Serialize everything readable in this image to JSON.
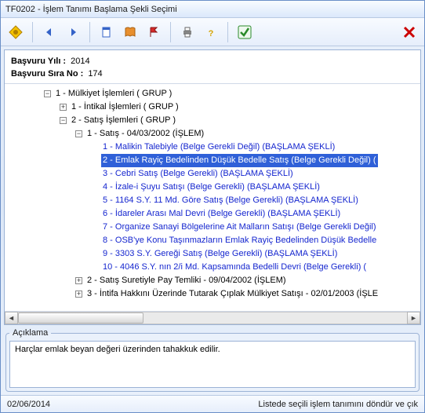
{
  "window_title": "TF0202 -  İşlem Tanımı Başlama Şekli Seçimi",
  "toolbar": {
    "icons": {
      "app": "app-icon",
      "prev": "prev-icon",
      "next": "next-icon",
      "new": "new-icon",
      "book": "book-icon",
      "flag": "flag-icon",
      "print": "print-icon",
      "help": "help-icon",
      "ok": "ok-icon",
      "close": "close-icon"
    }
  },
  "meta": {
    "year_label": "Başvuru Yılı  :",
    "year_value": "2014",
    "seq_label": "Başvuru Sıra No :",
    "seq_value": "174"
  },
  "tree": [
    {
      "d": 1,
      "exp": "-",
      "text": "1 - Mülkiyet İşlemleri ( GRUP )",
      "link": false,
      "sel": false
    },
    {
      "d": 2,
      "exp": "+",
      "text": "1 - İntikal İşlemleri ( GRUP )",
      "link": false,
      "sel": false
    },
    {
      "d": 2,
      "exp": "-",
      "text": "2 - Satış İşlemleri ( GRUP )",
      "link": false,
      "sel": false
    },
    {
      "d": 3,
      "exp": "-",
      "text": "1 - Satış - 04/03/2002 (İŞLEM)",
      "link": false,
      "sel": false
    },
    {
      "d": 4,
      "exp": "",
      "text": "1 - Malikin Talebiyle (Belge Gerekli Değil) (BAŞLAMA ŞEKLİ)",
      "link": true,
      "sel": false
    },
    {
      "d": 4,
      "exp": "",
      "text": "2 - Emlak Rayiç Bedelinden Düşük Bedelle Satış (Belge Gerekli Değil) (",
      "link": true,
      "sel": true
    },
    {
      "d": 4,
      "exp": "",
      "text": "3 - Cebri Satış (Belge Gerekli) (BAŞLAMA ŞEKLİ)",
      "link": true,
      "sel": false
    },
    {
      "d": 4,
      "exp": "",
      "text": "4 - İzale-i Şuyu Satışı (Belge Gerekli) (BAŞLAMA ŞEKLİ)",
      "link": true,
      "sel": false
    },
    {
      "d": 4,
      "exp": "",
      "text": "5 - 1164 S.Y. 11 Md. Göre Satış (Belge Gerekli) (BAŞLAMA ŞEKLİ)",
      "link": true,
      "sel": false
    },
    {
      "d": 4,
      "exp": "",
      "text": "6 - İdareler Arası Mal Devri (Belge Gerekli) (BAŞLAMA ŞEKLİ)",
      "link": true,
      "sel": false
    },
    {
      "d": 4,
      "exp": "",
      "text": "7 - Organize Sanayi Bölgelerine Ait Malların Satışı (Belge Gerekli Değil)",
      "link": true,
      "sel": false
    },
    {
      "d": 4,
      "exp": "",
      "text": "8 - OSB'ye Konu Taşınmazların Emlak Rayiç Bedelinden Düşük Bedelle",
      "link": true,
      "sel": false
    },
    {
      "d": 4,
      "exp": "",
      "text": "9 - 3303 S.Y. Gereği Satış (Belge Gerekli) (BAŞLAMA ŞEKLİ)",
      "link": true,
      "sel": false
    },
    {
      "d": 4,
      "exp": "",
      "text": "10 - 4046 S.Y. nın 2/i Md. Kapsamında Bedelli Devri (Belge Gerekli) (",
      "link": true,
      "sel": false
    },
    {
      "d": 3,
      "exp": "+",
      "text": "2 - Satış Suretiyle Pay Temliki - 09/04/2002 (İŞLEM)",
      "link": false,
      "sel": false
    },
    {
      "d": 3,
      "exp": "+",
      "text": "3 - İntifa Hakkını Üzerinde Tutarak Çıplak Mülkiyet Satışı - 02/01/2003 (İŞLE",
      "link": false,
      "sel": false
    }
  ],
  "description": {
    "legend": "Açıklama",
    "text": "Harçlar emlak beyan değeri üzerinden tahakkuk edilir."
  },
  "status": {
    "left": "02/06/2014",
    "right": "Listede seçili işlem tanımını döndür ve çık"
  }
}
